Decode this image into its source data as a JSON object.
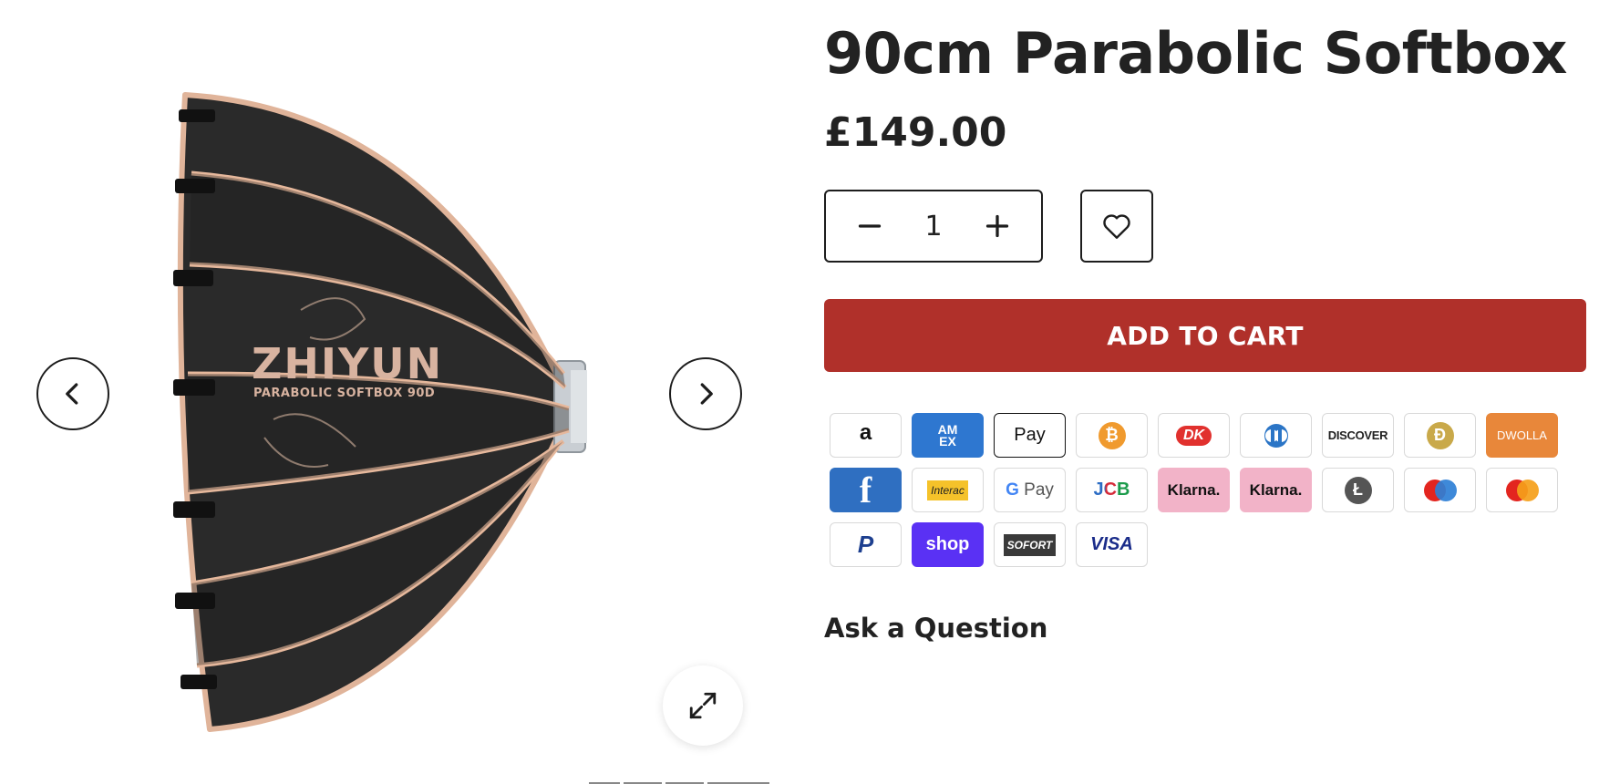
{
  "product": {
    "title": "90cm Parabolic Softbox",
    "price": "£149.00",
    "quantity": "1",
    "add_to_cart_label": "ADD TO CART",
    "ask_question_label": "Ask a Question"
  },
  "image": {
    "brand_text": "ZHIYUN",
    "model_text": "PARABOLIC SOFTBOX 90D"
  },
  "icons": {
    "prev": "chevron-left-icon",
    "next": "chevron-right-icon",
    "zoom": "expand-icon",
    "minus": "minus-icon",
    "plus": "plus-icon",
    "wishlist": "heart-icon"
  },
  "payment_methods": [
    {
      "name": "amazon",
      "label": "a"
    },
    {
      "name": "american-express",
      "label": "AM EX"
    },
    {
      "name": "apple-pay",
      "label": "Pay"
    },
    {
      "name": "bitcoin",
      "label": "₿"
    },
    {
      "name": "dankort",
      "label": "DK"
    },
    {
      "name": "diners-club",
      "label": ""
    },
    {
      "name": "discover",
      "label": "DISCOVER"
    },
    {
      "name": "dogecoin",
      "label": "Ð"
    },
    {
      "name": "dwolla",
      "label": "DWOLLA"
    },
    {
      "name": "forbrugsforeningen",
      "label": "f"
    },
    {
      "name": "interac",
      "label": "Interac"
    },
    {
      "name": "google-pay",
      "label": "Pay"
    },
    {
      "name": "jcb",
      "label": "JCB"
    },
    {
      "name": "klarna",
      "label": "Klarna."
    },
    {
      "name": "klarna-2",
      "label": "Klarna."
    },
    {
      "name": "litecoin",
      "label": "Ł"
    },
    {
      "name": "maestro",
      "label": ""
    },
    {
      "name": "mastercard",
      "label": ""
    },
    {
      "name": "paypal",
      "label": "P"
    },
    {
      "name": "shop-pay",
      "label": "shop"
    },
    {
      "name": "sofort",
      "label": "SOFORT"
    },
    {
      "name": "visa",
      "label": "VISA"
    }
  ],
  "colors": {
    "accent": "#b0302a",
    "text": "#222222",
    "border": "#1d1d1d"
  }
}
